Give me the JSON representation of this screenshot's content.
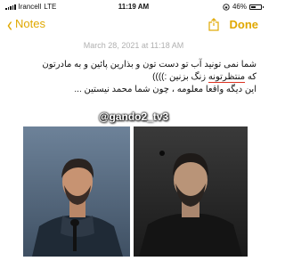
{
  "status_bar": {
    "carrier": "Irancell",
    "network": "LTE",
    "time": "11:19 AM",
    "battery": "46%",
    "battery_level": 0.46
  },
  "nav": {
    "back_label": "Notes",
    "done_label": "Done"
  },
  "note": {
    "date": "March 28, 2021 at 11:18 AM",
    "lines": [
      "شما نمی تونید آب تو دست تون و بذارین پائین و به مادرتون",
      "که منتظرتونه زنگ بزنین :))))",
      "این دیگه واقعا معلومه ، چون شما محمد نیستین ..."
    ]
  },
  "watermark": "@gando2_tv3",
  "colors": {
    "accent": "#e0a800",
    "date_gray": "#b0b0b0",
    "photo_left_bg": "#5a6f86",
    "photo_right_bg": "#2a2a2a"
  }
}
